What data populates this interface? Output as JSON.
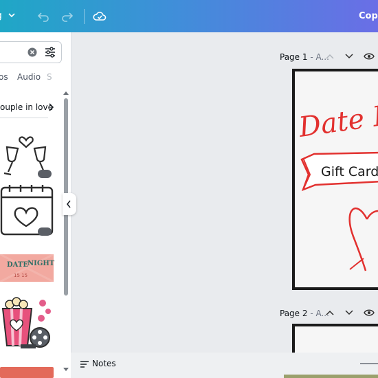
{
  "topbar": {
    "menu_label": "g",
    "copy_label": "Copy"
  },
  "panel": {
    "tabs": [
      "os",
      "Audio",
      "S"
    ],
    "breadcrumb": "ouple in love"
  },
  "canvas": {
    "pages": [
      {
        "label": "Page 1",
        "sub": " - A..."
      },
      {
        "label": "Page 2",
        "sub": " - A..."
      }
    ],
    "design_title": "Date N",
    "banner_text": "Gift Card"
  },
  "bottom": {
    "notes_label": "Notes"
  },
  "colors": {
    "accent_red": "#e2312f",
    "topbar_start": "#1fa7c6",
    "topbar_end": "#6a6ee6"
  },
  "icons": [
    "chevron-down-icon",
    "undo-icon",
    "redo-icon",
    "cloud-saved-icon",
    "clear-icon",
    "filter-icon",
    "chevron-right-icon",
    "heart-glasses-icon",
    "calendar-heart-icon",
    "popcorn-film-icon",
    "crown-icon",
    "chevron-left-icon",
    "chevron-up-icon",
    "eye-icon",
    "notes-icon"
  ]
}
